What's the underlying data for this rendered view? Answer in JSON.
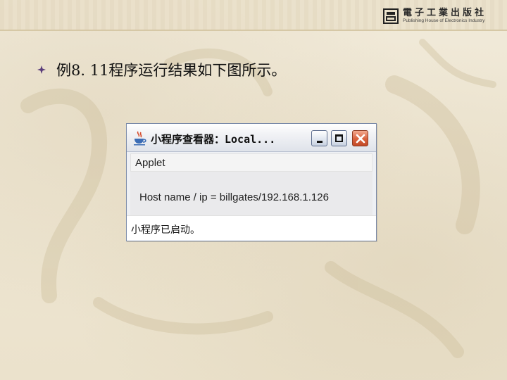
{
  "slide": {
    "publisher": {
      "name_cn": "電子工業出版社",
      "name_en": "Publishing House of Electronics Industry"
    },
    "bullet_icon": "diamond-bullet",
    "caption": "例8. 11程序运行结果如下图所示。"
  },
  "applet_window": {
    "icon": "java-cup-icon",
    "title": "小程序查看器：Local...",
    "controls": {
      "minimize": "minimize-icon",
      "maximize": "maximize-icon",
      "close": "close-icon"
    },
    "menu": [
      "Applet"
    ],
    "content_text": "Host name / ip = billgates/192.168.1.126",
    "status_text": "小程序已启动。"
  },
  "colors": {
    "background": "#ece4d2",
    "close_button": "#d9613d",
    "bullet": "#5a3d7a"
  }
}
